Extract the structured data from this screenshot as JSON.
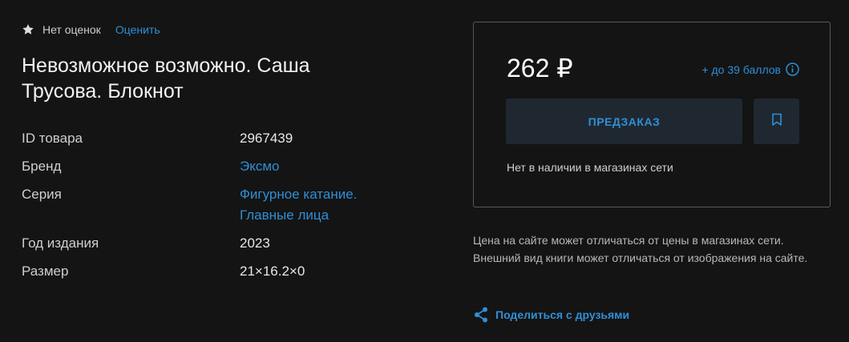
{
  "rating": {
    "icon": "star-icon",
    "text": "Нет оценок",
    "rate_link": "Оценить"
  },
  "product": {
    "title": "Невозможное возможно. Саша Трусова. Блокнот"
  },
  "specs": [
    {
      "key": "ID товара",
      "value": "2967439"
    },
    {
      "key": "Бренд",
      "value": "Эксмо"
    },
    {
      "key": "Серия",
      "value_line1": "Фигурное катание.",
      "value_line2": "Главные лица"
    },
    {
      "key": "Год издания",
      "value": "2023"
    },
    {
      "key": "Размер",
      "value": "21×16.2×0"
    }
  ],
  "buybox": {
    "price": "262 ₽",
    "bonus": "+ до 39 баллов",
    "preorder_label": "ПРЕДЗАКАЗ",
    "stock_text": "Нет в наличии в магазинах сети"
  },
  "disclaimer": "Цена на сайте может отличаться от цены в магазинах сети. Внешний вид книги может отличаться от изображения на сайте.",
  "share": {
    "label": "Поделиться с друзьями",
    "icon": "share-icon"
  },
  "colors": {
    "background": "#141414",
    "accent": "#2f8fd6",
    "button_bg": "#1f2830",
    "border": "#5a5a5a"
  }
}
